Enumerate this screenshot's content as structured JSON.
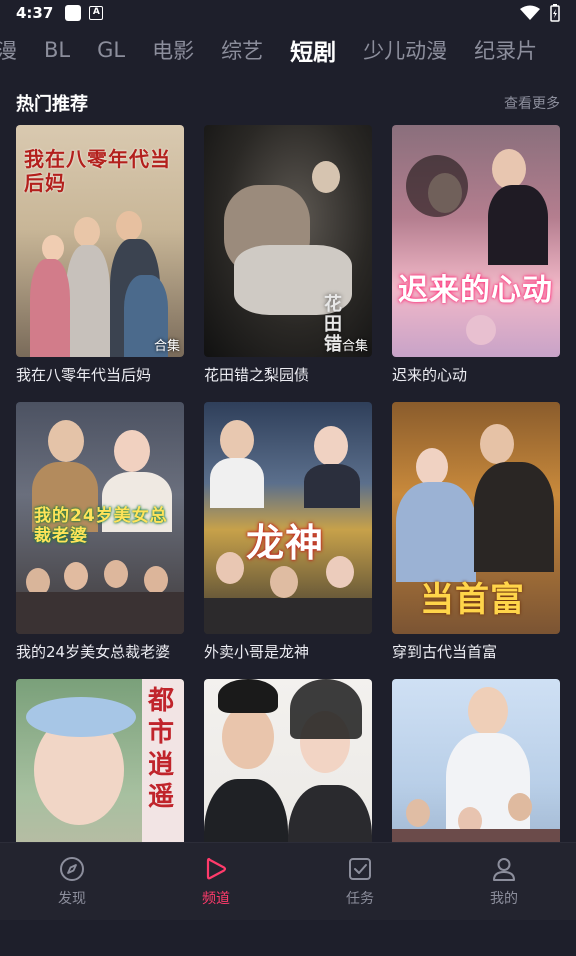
{
  "status": {
    "time": "4:37"
  },
  "tabs": [
    {
      "label": "漫"
    },
    {
      "label": "BL"
    },
    {
      "label": "GL"
    },
    {
      "label": "电影"
    },
    {
      "label": "综艺"
    },
    {
      "label": "短剧"
    },
    {
      "label": "少儿动漫"
    },
    {
      "label": "纪录片"
    }
  ],
  "active_tab": "短剧",
  "section": {
    "title": "热门推荐",
    "more": "查看更多"
  },
  "items": [
    {
      "title": "我在八零年代当后妈",
      "badge": "合集",
      "poster_text": "我在八零年代当后妈"
    },
    {
      "title": "花田错之梨园债",
      "badge": "合集",
      "poster_text": "花田错"
    },
    {
      "title": "迟来的心动",
      "badge": "",
      "poster_text": "迟来的心动"
    },
    {
      "title": "我的24岁美女总裁老婆",
      "badge": "",
      "poster_text": "我的24岁美女总裁老婆"
    },
    {
      "title": "外卖小哥是龙神",
      "badge": "",
      "poster_text": "龙神"
    },
    {
      "title": "穿到古代当首富",
      "badge": "",
      "poster_text": "当首富"
    },
    {
      "title": "",
      "badge": "",
      "poster_text": "都市逍遥"
    },
    {
      "title": "",
      "badge": "",
      "poster_text": ""
    },
    {
      "title": "",
      "badge": "",
      "poster_text": ""
    }
  ],
  "nav": [
    {
      "label": "发现",
      "icon": "compass-icon"
    },
    {
      "label": "频道",
      "icon": "play-icon"
    },
    {
      "label": "任务",
      "icon": "task-icon"
    },
    {
      "label": "我的",
      "icon": "user-icon"
    }
  ],
  "colors": {
    "accent": "#ff3b6b",
    "background": "#1e1f2b",
    "nav_background": "#23242f"
  }
}
